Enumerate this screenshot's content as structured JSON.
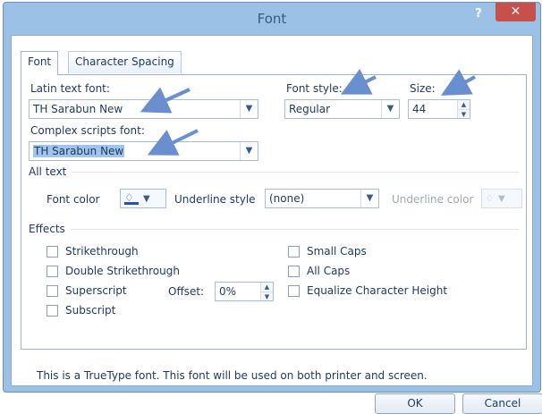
{
  "window": {
    "title": "Font",
    "help_label": "?",
    "close_label": "✕"
  },
  "tabs": [
    {
      "label": "Font",
      "active": true
    },
    {
      "label": "Character Spacing",
      "active": false
    }
  ],
  "latin_font": {
    "label": "Latin text font:",
    "value": "TH Sarabun New"
  },
  "font_style": {
    "label": "Font style:",
    "value": "Regular"
  },
  "size": {
    "label": "Size:",
    "value": "44"
  },
  "complex_font": {
    "label": "Complex scripts font:",
    "value": "TH Sarabun New"
  },
  "all_text": {
    "section_label": "All text",
    "font_color_label": "Font color",
    "underline_style_label": "Underline style",
    "underline_style_value": "(none)",
    "underline_color_label": "Underline color"
  },
  "effects": {
    "section_label": "Effects",
    "strikethrough": "Strikethrough",
    "double_strikethrough": "Double Strikethrough",
    "superscript": "Superscript",
    "subscript": "Subscript",
    "offset_label": "Offset:",
    "offset_value": "0%",
    "small_caps": "Small Caps",
    "all_caps": "All Caps",
    "equalize": "Equalize Character Height"
  },
  "status_text": "This is a TrueType font. This font will be used on both printer and screen.",
  "buttons": {
    "ok": "OK",
    "cancel": "Cancel"
  },
  "colors": {
    "title_bar": "#9bc1e6",
    "close_button": "#c7504b",
    "selection": "#9fc4ee",
    "annotation_arrow": "#6a8fcf",
    "font_color_swatch": "#2553a8"
  },
  "icons": {
    "dropdown": "chevron-down-icon",
    "paint_bucket": "paint-bucket-icon",
    "spin": "spinner-icon"
  }
}
